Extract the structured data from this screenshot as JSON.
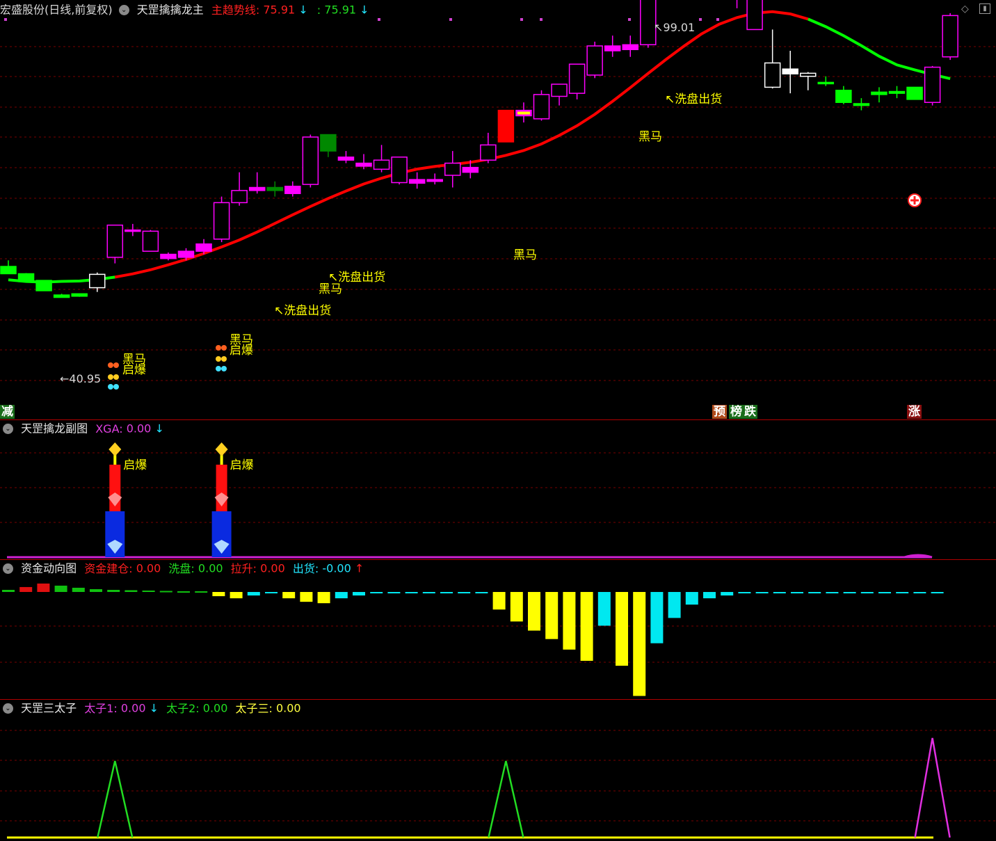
{
  "main": {
    "stock": "宏盛股份(日线,前复权)",
    "indicator": "天罡擒擒龙主",
    "trend_label": "主趋势线:",
    "trend_value": "75.91",
    "trend_arrow": "↓",
    "trend2_label": ":",
    "trend2_value": "75.91",
    "trend2_arrow": "↓",
    "high_label": "99.01",
    "low_label": "40.95",
    "signals": [
      "黑马",
      "启爆",
      "洗盘出货"
    ],
    "bottom_tags": {
      "left": "减",
      "pre": "预",
      "bang": "榜",
      "die": "跌",
      "zhang": "涨"
    }
  },
  "sub1": {
    "title": "天罡擒龙副图",
    "label": "XGA:",
    "value": "0.00",
    "arrow": "↓",
    "signal": "启爆"
  },
  "sub2": {
    "title": "资金动向图",
    "items": [
      {
        "label": "资金建仓:",
        "value": "0.00",
        "color": "#ff2020"
      },
      {
        "label": "洗盘:",
        "value": "0.00",
        "color": "#22dd22"
      },
      {
        "label": "拉升:",
        "value": "0.00",
        "color": "#ff2020"
      },
      {
        "label": "出货:",
        "value": "-0.00",
        "color": "#22e6ff"
      }
    ],
    "arrow": "↑"
  },
  "sub3": {
    "title": "天罡三太子",
    "items": [
      {
        "label": "太子1:",
        "value": "0.00",
        "color": "#e040e0"
      },
      {
        "label": "太子2:",
        "value": "0.00",
        "color": "#22dd22"
      },
      {
        "label": "太子三:",
        "value": "0.00",
        "color": "#ffff40"
      }
    ],
    "arrow": "↓"
  },
  "colors": {
    "up": "#ff00ff",
    "down": "#00ff00",
    "dkgreen": "#008800",
    "red": "#ff0000",
    "yellow": "#ffff00",
    "cyan": "#00e8f0",
    "grid": "#7a0000"
  },
  "candles": [
    {
      "o": 59.5,
      "h": 60.5,
      "l": 58.3,
      "c": 58.3,
      "k": "g"
    },
    {
      "o": 58.3,
      "h": 58.4,
      "l": 57,
      "c": 57,
      "k": "g"
    },
    {
      "o": 57.2,
      "h": 57.2,
      "l": 55.5,
      "c": 55.5,
      "k": "g"
    },
    {
      "o": 54.8,
      "h": 55,
      "l": 54.4,
      "c": 54.4,
      "k": "g"
    },
    {
      "o": 55,
      "h": 55,
      "l": 54.5,
      "c": 54.6,
      "k": "g"
    },
    {
      "o": 56,
      "h": 58.5,
      "l": 55.3,
      "c": 58.2,
      "k": "w"
    },
    {
      "o": 61,
      "h": 66.3,
      "l": 60,
      "c": 66.3,
      "k": "m"
    },
    {
      "o": 65.5,
      "h": 66.5,
      "l": 64.5,
      "c": 65.5,
      "k": "m"
    },
    {
      "o": 62,
      "h": 65.5,
      "l": 62,
      "c": 65.3,
      "k": "m"
    },
    {
      "o": 60.8,
      "h": 61.8,
      "l": 60.5,
      "c": 61.5,
      "k": "m"
    },
    {
      "o": 61,
      "h": 62.5,
      "l": 60.5,
      "c": 62,
      "k": "m"
    },
    {
      "o": 62,
      "h": 64,
      "l": 61.5,
      "c": 63.2,
      "k": "m"
    },
    {
      "o": 64,
      "h": 71,
      "l": 63.5,
      "c": 70,
      "k": "m"
    },
    {
      "o": 70,
      "h": 75,
      "l": 69.5,
      "c": 72,
      "k": "m"
    },
    {
      "o": 72,
      "h": 75,
      "l": 71.5,
      "c": 72.5,
      "k": "m"
    },
    {
      "o": 72.5,
      "h": 73.5,
      "l": 71,
      "c": 72,
      "k": "dg"
    },
    {
      "o": 71.5,
      "h": 73.5,
      "l": 71,
      "c": 72.7,
      "k": "m"
    },
    {
      "o": 73,
      "h": 81.2,
      "l": 72.5,
      "c": 80.8,
      "k": "m"
    },
    {
      "o": 81.2,
      "h": 81.2,
      "l": 77.5,
      "c": 78.5,
      "k": "dg"
    },
    {
      "o": 77.5,
      "h": 78.5,
      "l": 76.5,
      "c": 77,
      "k": "m"
    },
    {
      "o": 76.5,
      "h": 78,
      "l": 75.5,
      "c": 76,
      "k": "m"
    },
    {
      "o": 75.5,
      "h": 79.5,
      "l": 75,
      "c": 77,
      "k": "m"
    },
    {
      "o": 73.3,
      "h": 77.5,
      "l": 73,
      "c": 77.5,
      "k": "m"
    },
    {
      "o": 73.2,
      "h": 75,
      "l": 72.3,
      "c": 73.8,
      "k": "m"
    },
    {
      "o": 73.5,
      "h": 74.8,
      "l": 73,
      "c": 73.8,
      "k": "m"
    },
    {
      "o": 74.5,
      "h": 78.5,
      "l": 72.5,
      "c": 76.5,
      "k": "m"
    },
    {
      "o": 75,
      "h": 77,
      "l": 74,
      "c": 75.8,
      "k": "m"
    },
    {
      "o": 77,
      "h": 81.5,
      "l": 76.5,
      "c": 79.5,
      "k": "m"
    },
    {
      "o": 80,
      "h": 85.2,
      "l": 80,
      "c": 85.2,
      "k": "r"
    },
    {
      "o": 84.3,
      "h": 86.5,
      "l": 83.2,
      "c": 85.2,
      "k": "ym"
    },
    {
      "o": 83.8,
      "h": 88.5,
      "l": 83.5,
      "c": 87.8,
      "k": "m"
    },
    {
      "o": 87.5,
      "h": 89.5,
      "l": 86,
      "c": 89.5,
      "k": "m"
    },
    {
      "o": 88,
      "h": 92.5,
      "l": 87,
      "c": 92.8,
      "k": "m"
    },
    {
      "o": 91,
      "h": 96.5,
      "l": 90.5,
      "c": 95.8,
      "k": "m"
    },
    {
      "o": 95,
      "h": 97.5,
      "l": 94,
      "c": 95.8,
      "k": "m"
    },
    {
      "o": 95.2,
      "h": 97.5,
      "l": 94,
      "c": 96,
      "k": "m"
    },
    {
      "o": 96,
      "h": 104.2,
      "l": 95.5,
      "c": 104.2,
      "k": "m"
    },
    {
      "o": 105,
      "h": 110.2,
      "l": 104,
      "c": 110,
      "k": "m"
    },
    {
      "o": 110,
      "h": 110,
      "l": 105.5,
      "c": 105.5,
      "k": "dg"
    },
    {
      "o": 105.2,
      "h": 107.5,
      "l": 104,
      "c": 106,
      "k": "m"
    },
    {
      "o": 105.2,
      "h": 106.5,
      "l": 104.5,
      "c": 105.8,
      "k": "m"
    },
    {
      "o": 103.8,
      "h": 104.8,
      "l": 102,
      "c": 104,
      "k": "m"
    },
    {
      "o": 98.5,
      "h": 104.8,
      "l": 98.5,
      "c": 103.5,
      "k": "m"
    },
    {
      "o": 89,
      "h": 98.5,
      "l": 88.8,
      "c": 93,
      "k": "w"
    },
    {
      "o": 92,
      "h": 95,
      "l": 88,
      "c": 91.2,
      "k": "wf"
    },
    {
      "o": 91.3,
      "h": 91.5,
      "l": 88.5,
      "c": 90.8,
      "k": "w"
    },
    {
      "o": 89.6,
      "h": 90.8,
      "l": 89.2,
      "c": 89.8,
      "k": "g"
    },
    {
      "o": 88.5,
      "h": 89.2,
      "l": 86.2,
      "c": 86.5,
      "k": "g"
    },
    {
      "o": 86.3,
      "h": 87.2,
      "l": 85.2,
      "c": 86,
      "k": "g"
    },
    {
      "o": 88.2,
      "h": 89,
      "l": 86.5,
      "c": 87.8,
      "k": "g"
    },
    {
      "o": 88.3,
      "h": 89.2,
      "l": 87.2,
      "c": 88,
      "k": "g"
    },
    {
      "o": 89,
      "h": 89,
      "l": 87,
      "c": 87,
      "k": "g"
    },
    {
      "o": 86.5,
      "h": 92.5,
      "l": 86,
      "c": 92.3,
      "k": "m"
    },
    {
      "o": 94,
      "h": 101.2,
      "l": 93.5,
      "c": 100.8,
      "k": "m"
    }
  ],
  "money": [
    {
      "v": 0.3,
      "c": "g"
    },
    {
      "v": 0.7,
      "c": "r"
    },
    {
      "v": 1.2,
      "c": "r"
    },
    {
      "v": 0.9,
      "c": "g"
    },
    {
      "v": 0.6,
      "c": "g"
    },
    {
      "v": 0.4,
      "c": "g"
    },
    {
      "v": 0.3,
      "c": "g"
    },
    {
      "v": 0.25,
      "c": "g"
    },
    {
      "v": 0.2,
      "c": "g"
    },
    {
      "v": 0.15,
      "c": "g"
    },
    {
      "v": 0.1,
      "c": "g"
    },
    {
      "v": 0.1,
      "c": "g"
    },
    {
      "v": -0.6,
      "c": "y"
    },
    {
      "v": -0.9,
      "c": "y"
    },
    {
      "v": -0.5,
      "c": "c"
    },
    {
      "v": -0.2,
      "c": "c"
    },
    {
      "v": -0.9,
      "c": "y"
    },
    {
      "v": -1.4,
      "c": "y"
    },
    {
      "v": -1.6,
      "c": "y"
    },
    {
      "v": -0.9,
      "c": "c"
    },
    {
      "v": -0.5,
      "c": "c"
    },
    {
      "v": -0.2,
      "c": "c"
    },
    {
      "v": -0.2,
      "c": "c"
    },
    {
      "v": -0.2,
      "c": "c"
    },
    {
      "v": -0.2,
      "c": "c"
    },
    {
      "v": -0.2,
      "c": "c"
    },
    {
      "v": -0.2,
      "c": "c"
    },
    {
      "v": -0.2,
      "c": "c"
    },
    {
      "v": -2.5,
      "c": "y"
    },
    {
      "v": -4.2,
      "c": "y"
    },
    {
      "v": -5.5,
      "c": "y"
    },
    {
      "v": -6.7,
      "c": "y"
    },
    {
      "v": -8.2,
      "c": "y"
    },
    {
      "v": -9.8,
      "c": "y"
    },
    {
      "v": -4.8,
      "c": "c"
    },
    {
      "v": -10.5,
      "c": "y"
    },
    {
      "v": -14.8,
      "c": "y"
    },
    {
      "v": -7.3,
      "c": "c"
    },
    {
      "v": -3.7,
      "c": "c"
    },
    {
      "v": -1.8,
      "c": "c"
    },
    {
      "v": -0.9,
      "c": "c"
    },
    {
      "v": -0.5,
      "c": "c"
    },
    {
      "v": -0.2,
      "c": "c"
    },
    {
      "v": -0.2,
      "c": "c"
    },
    {
      "v": -0.2,
      "c": "c"
    },
    {
      "v": -0.2,
      "c": "c"
    },
    {
      "v": -0.2,
      "c": "c"
    },
    {
      "v": -0.2,
      "c": "c"
    },
    {
      "v": -0.2,
      "c": "c"
    },
    {
      "v": -0.2,
      "c": "c"
    },
    {
      "v": -0.2,
      "c": "c"
    },
    {
      "v": -0.2,
      "c": "c"
    },
    {
      "v": -0.2,
      "c": "c"
    },
    {
      "v": -0.2,
      "c": "c"
    }
  ],
  "princes": [
    {
      "index": 6,
      "level": 1,
      "color": "g"
    },
    {
      "index": 28,
      "level": 1,
      "color": "g"
    },
    {
      "index": 52,
      "level": 1.3,
      "color": "m"
    }
  ],
  "sub1_bars": [
    6,
    12
  ]
}
